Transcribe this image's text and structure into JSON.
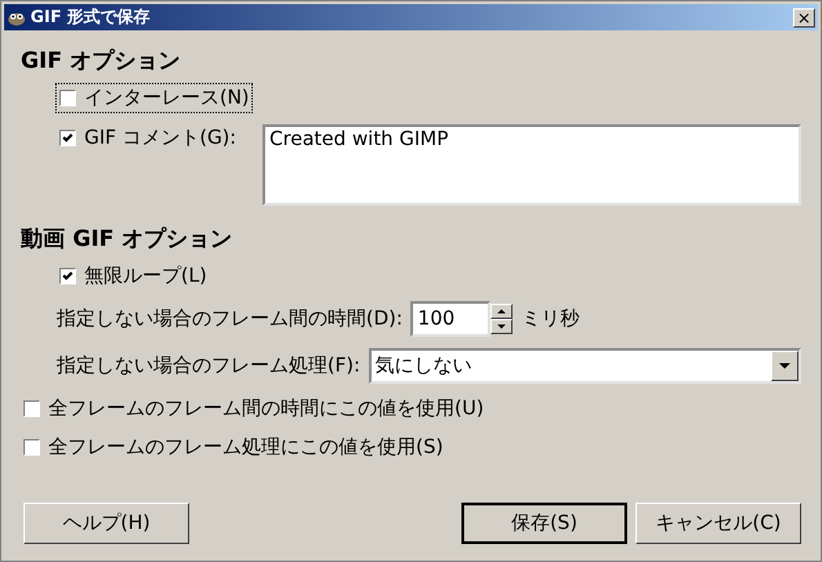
{
  "window": {
    "title": "GIF 形式で保存",
    "close": "×"
  },
  "gif_options": {
    "heading": "GIF オプション",
    "interlace": {
      "label": "インターレース(N)",
      "checked": false,
      "focused": true
    },
    "comment": {
      "label": "GIF コメント(G):",
      "checked": true,
      "value": "Created with GIMP"
    }
  },
  "animation_options": {
    "heading": "動画 GIF オプション",
    "loop": {
      "label": "無限ループ(L)",
      "checked": true
    },
    "delay": {
      "label": "指定しない場合のフレーム間の時間(D):",
      "value": "100",
      "unit": "ミリ秒"
    },
    "disposal": {
      "label": "指定しない場合のフレーム処理(F):",
      "value": "気にしない"
    },
    "use_delay_for_all": {
      "label": "全フレームのフレーム間の時間にこの値を使用(U)",
      "checked": false
    },
    "use_disposal_for_all": {
      "label": "全フレームのフレーム処理にこの値を使用(S)",
      "checked": false
    }
  },
  "buttons": [
    {
      "label": "ヘルプ(H)",
      "default": false
    },
    {
      "label": "保存(S)",
      "default": true
    },
    {
      "label": "キャンセル(C)",
      "default": false
    }
  ]
}
